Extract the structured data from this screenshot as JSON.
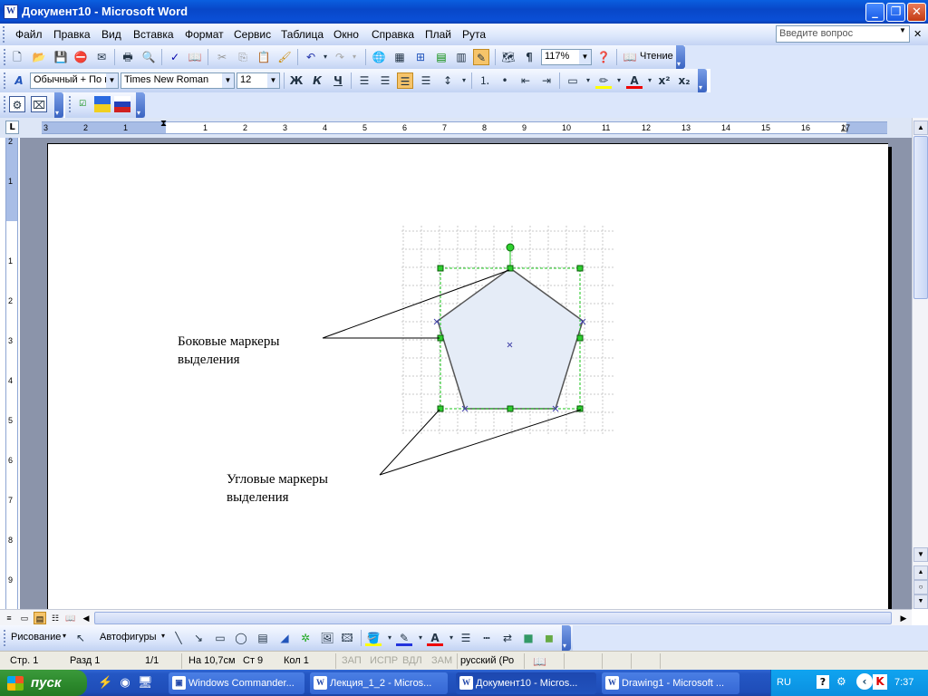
{
  "window": {
    "title": "Документ10 - Microsoft Word",
    "doc_icon": "W",
    "minimize_icon": "minimize-icon",
    "restore_icon": "restore-icon",
    "close_icon": "close-icon"
  },
  "menu": {
    "items": [
      "Файл",
      "Правка",
      "Вид",
      "Вставка",
      "Формат",
      "Сервис",
      "Таблица",
      "Окно",
      "Справка",
      "Плай",
      "Рута"
    ],
    "ask_placeholder": "Введите вопрос"
  },
  "standard_toolbar": {
    "zoom": "117%",
    "reading_label": "Чтение",
    "pilcrow": "¶"
  },
  "format_toolbar": {
    "style": "Обычный + По г",
    "font": "Times New Roman",
    "size": "12",
    "bold": "Ж",
    "italic": "К",
    "underline": "Ч",
    "fontcolor_letter": "A",
    "superscript": "x²",
    "subscript": "x₂"
  },
  "ruler": {
    "h_numbers": [
      "3",
      "2",
      "1",
      "1",
      "2",
      "3",
      "4",
      "5",
      "6",
      "7",
      "8",
      "9",
      "10",
      "11",
      "12",
      "13",
      "14",
      "15",
      "16",
      "17"
    ],
    "v_numbers": [
      "2",
      "1",
      "1",
      "2",
      "3",
      "4",
      "5",
      "6",
      "7",
      "8",
      "9"
    ],
    "tab_marker": "L"
  },
  "document": {
    "label_side": [
      "Боковые маркеры",
      "выделения"
    ],
    "label_corner": [
      "Угловые маркеры",
      "выделения"
    ]
  },
  "drawing_toolbar": {
    "draw_label": "Рисование",
    "autoshapes_label": "Автофигуры",
    "font_color_letter": "A"
  },
  "statusbar": {
    "page": "Стр. 1",
    "section": "Разд 1",
    "pages": "1/1",
    "at": "На 10,7см",
    "line": "Ст 9",
    "col": "Кол 1",
    "rec": "ЗАП",
    "trk": "ИСПР",
    "ext": "ВДЛ",
    "ovr": "ЗАМ",
    "lang": "русский (Ро"
  },
  "taskbar": {
    "start_label": "пуск",
    "tasks": [
      "Windows Commander...",
      "Лекция_1_2 - Micros...",
      "Документ10 - Micros...",
      "Drawing1 - Microsoft ..."
    ],
    "lang": "RU",
    "clock": "7:37"
  }
}
